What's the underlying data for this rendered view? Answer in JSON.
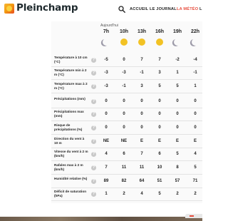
{
  "header": {
    "brand": "Pleinchamp",
    "nav": [
      "ACCUEIL",
      "LE JOURNAL",
      "LA MÉTÉO",
      "L"
    ]
  },
  "forecast": {
    "day_label": "Aujourd'hui",
    "hours": [
      "7h",
      "10h",
      "13h",
      "16h",
      "19h",
      "22h"
    ],
    "weather_icons": [
      "moon-icon",
      "sun-icon",
      "sun-icon",
      "sun-icon",
      "moon-icon",
      "moon-icon"
    ],
    "colors": {
      "sun": "#f2c224",
      "moon": "#9d9ba9",
      "accent": "#e74c3c"
    },
    "rows": [
      {
        "label": "Température à 10 cm (°C)",
        "values": [
          "-5",
          "0",
          "7",
          "7",
          "-2",
          "-4"
        ]
      },
      {
        "label": "Température min à 2 m (°C)",
        "values": [
          "-3",
          "-3",
          "-1",
          "3",
          "1",
          "-1"
        ]
      },
      {
        "label": "Température max à 2 m (°C)",
        "values": [
          "-3",
          "-1",
          "3",
          "5",
          "5",
          "1"
        ]
      },
      {
        "label": "Précipitations (mm)",
        "values": [
          "0",
          "0",
          "0",
          "0",
          "0",
          "0"
        ]
      },
      {
        "label": "Précipitations max (mm)",
        "values": [
          "0",
          "0",
          "0",
          "0",
          "0",
          "0"
        ]
      },
      {
        "label": "Risque de précipitations (%)",
        "values": [
          "0",
          "0",
          "0",
          "0",
          "0",
          "0"
        ]
      },
      {
        "label": "Direction du vent à 10 m",
        "values": [
          "NE",
          "NE",
          "E",
          "E",
          "E",
          "E"
        ]
      },
      {
        "label": "Vitesse du vent à 2 m (km/h)",
        "values": [
          "4",
          "6",
          "7",
          "6",
          "5",
          "4"
        ]
      },
      {
        "label": "Rafales max à 2 m (km/h)",
        "values": [
          "7",
          "11",
          "11",
          "10",
          "8",
          "5"
        ]
      },
      {
        "label": "Humidité relative (%)",
        "values": [
          "89",
          "82",
          "64",
          "51",
          "57",
          "71"
        ]
      },
      {
        "label": "Déficit de saturation (hPa)",
        "values": [
          "1",
          "2",
          "4",
          "5",
          "2",
          "2"
        ]
      }
    ]
  }
}
